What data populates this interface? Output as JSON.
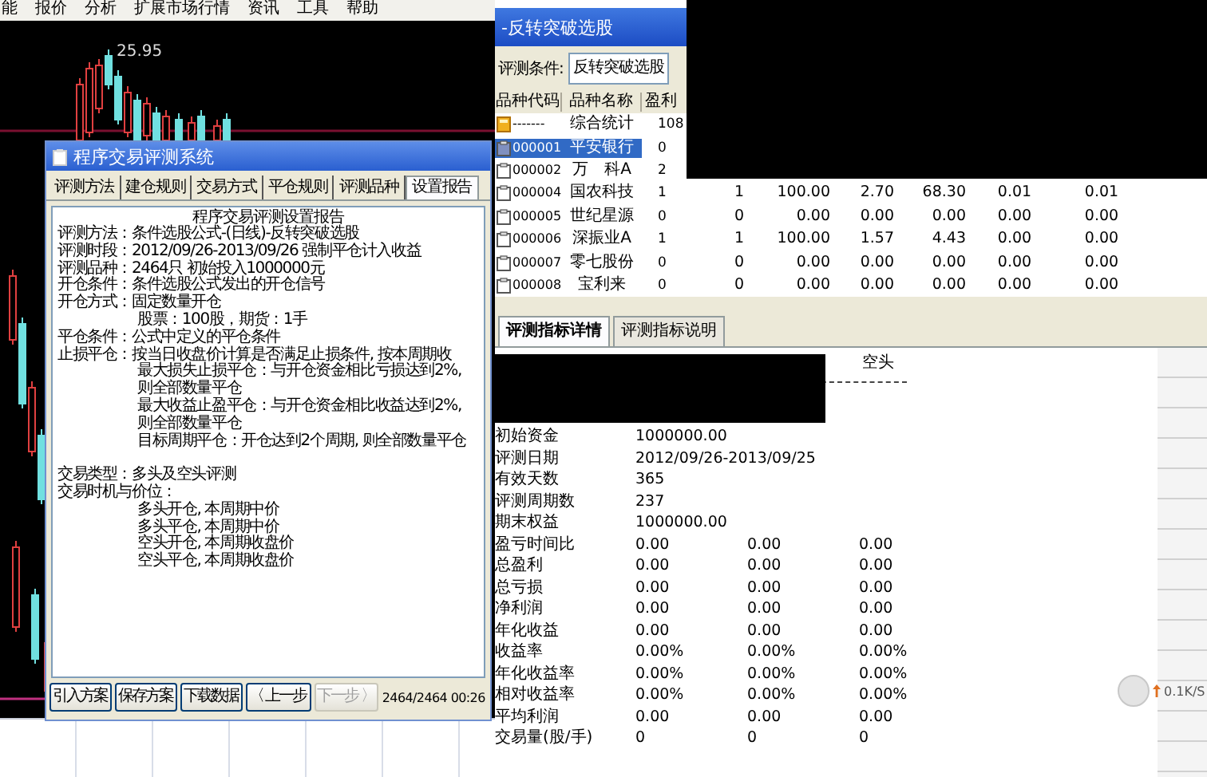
{
  "menu_bar": {
    "items": [
      "能",
      "报价",
      "分析",
      "扩展市场行情",
      "资讯",
      "工具",
      "帮助"
    ]
  },
  "chart": {
    "price_label": "25.95"
  },
  "evaluation_dialog": {
    "title": "程序交易评测系统",
    "tabs": [
      {
        "label": "评测方法",
        "selected": false
      },
      {
        "label": "建仓规则",
        "selected": false
      },
      {
        "label": "交易方式",
        "selected": false
      },
      {
        "label": "平仓规则",
        "selected": false
      },
      {
        "label": "评测品种",
        "selected": false
      },
      {
        "label": "设置报告",
        "selected": true
      }
    ],
    "report": {
      "heading": "程序交易评测设置报告",
      "lines": [
        {
          "kind": "field",
          "label": "评测方法：",
          "text": "条件选股公式-(日线)-反转突破选股"
        },
        {
          "kind": "field",
          "label": "评测时段：",
          "text": "2012/09/26-2013/09/26 强制平仓计入收益"
        },
        {
          "kind": "field",
          "label": "评测品种：",
          "text": "2464只 初始投入1000000元"
        },
        {
          "kind": "field",
          "label": "开仓条件：",
          "text": "条件选股公式发出的开仓信号"
        },
        {
          "kind": "field",
          "label": "开仓方式：",
          "text": "固定数量开仓"
        },
        {
          "kind": "sub",
          "text": "股票：100股，期货：1手"
        },
        {
          "kind": "field",
          "label": "平仓条件：",
          "text": "公式中定义的平仓条件"
        },
        {
          "kind": "field",
          "label": "止损平仓：",
          "text": "按当日收盘价计算是否满足止损条件, 按本周期收"
        },
        {
          "kind": "sub",
          "text": "最大损失止损平仓：与开仓资金相比亏损达到2%, 则全部数量平仓"
        },
        {
          "kind": "sub",
          "text": "最大收益止盈平仓：与开仓资金相比收益达到2%, 则全部数量平仓"
        },
        {
          "kind": "sub",
          "text": "目标周期平仓：开仓达到2个周期, 则全部数量平仓"
        },
        {
          "kind": "gap"
        },
        {
          "kind": "field",
          "label": "交易类型：",
          "text": "多头及空头评测"
        },
        {
          "kind": "field",
          "label": "交易时机与价位："
        },
        {
          "kind": "sub",
          "text": "多头开仓, 本周期中价"
        },
        {
          "kind": "sub",
          "text": "多头平仓, 本周期中价"
        },
        {
          "kind": "sub",
          "text": "空头开仓, 本周期收盘价"
        },
        {
          "kind": "sub",
          "text": "空头平仓, 本周期收盘价"
        }
      ]
    },
    "buttons": [
      {
        "label": "引入方案",
        "disabled": false
      },
      {
        "label": "保存方案",
        "disabled": false
      },
      {
        "label": "下载数据",
        "disabled": false
      },
      {
        "label": "〈 上一步",
        "disabled": false
      },
      {
        "label": "下一步 〉",
        "disabled": true
      }
    ],
    "progress_text": "2464/2464 00:26"
  },
  "screening_dialog": {
    "title": "-反转突破选股",
    "condition_label": "评测条件:",
    "condition_value": "反转突破选股",
    "columns": [
      "品种代码",
      "品种名称",
      "盈利"
    ],
    "rows": [
      {
        "kind": "summary",
        "code": "-------",
        "name": "综合统计",
        "selected": false,
        "values": [
          "108"
        ]
      },
      {
        "kind": "stock",
        "code": "000001",
        "name": "平安银行",
        "selected": true,
        "values": [
          "0"
        ]
      },
      {
        "kind": "stock",
        "code": "000002",
        "name": "万　科A",
        "selected": false,
        "values": [
          "2"
        ]
      },
      {
        "kind": "stock",
        "code": "000004",
        "name": "国农科技",
        "selected": false,
        "values": [
          "1",
          "1",
          "100.00",
          "2.70",
          "68.30",
          "0.01",
          "0.01"
        ]
      },
      {
        "kind": "stock",
        "code": "000005",
        "name": "世纪星源",
        "selected": false,
        "values": [
          "0",
          "0",
          "0.00",
          "0.00",
          "0.00",
          "0.00",
          "0.00"
        ]
      },
      {
        "kind": "stock",
        "code": "000006",
        "name": "深振业A",
        "selected": false,
        "values": [
          "1",
          "1",
          "100.00",
          "1.57",
          "4.43",
          "0.00",
          "0.00"
        ]
      },
      {
        "kind": "stock",
        "code": "000007",
        "name": "零七股份",
        "selected": false,
        "values": [
          "0",
          "0",
          "0.00",
          "0.00",
          "0.00",
          "0.00",
          "0.00"
        ]
      },
      {
        "kind": "stock",
        "code": "000008",
        "name": "宝利来",
        "selected": false,
        "values": [
          "0",
          "0",
          "0.00",
          "0.00",
          "0.00",
          "0.00",
          "0.00"
        ]
      }
    ],
    "tabs": [
      {
        "label": "评测指标详情",
        "selected": true
      },
      {
        "label": "评测指标说明",
        "selected": false
      }
    ],
    "report": {
      "column_header": "空头",
      "rows": [
        {
          "label": "初始资金",
          "values": [
            "1000000.00"
          ]
        },
        {
          "label": "评测日期",
          "values": [
            "2012/09/26-2013/09/25"
          ]
        },
        {
          "label": "有效天数",
          "values": [
            "365"
          ]
        },
        {
          "label": "评测周期数",
          "values": [
            "237"
          ]
        },
        {
          "label": "期末权益",
          "values": [
            "1000000.00"
          ]
        },
        {
          "label": "盈亏时间比",
          "values": [
            "0.00",
            "0.00",
            "0.00"
          ]
        },
        {
          "label": "总盈利",
          "values": [
            "0.00",
            "0.00",
            "0.00"
          ]
        },
        {
          "label": "总亏损",
          "values": [
            "0.00",
            "0.00",
            "0.00"
          ]
        },
        {
          "label": "净利润",
          "values": [
            "0.00",
            "0.00",
            "0.00"
          ]
        },
        {
          "label": "年化收益",
          "values": [
            "0.00",
            "0.00",
            "0.00"
          ]
        },
        {
          "label": "收益率",
          "values": [
            "0.00%",
            "0.00%",
            "0.00%"
          ]
        },
        {
          "label": "年化收益率",
          "values": [
            "0.00%",
            "0.00%",
            "0.00%"
          ]
        },
        {
          "label": "相对收益率",
          "values": [
            "0.00%",
            "0.00%",
            "0.00%"
          ]
        },
        {
          "label": "平均利润",
          "values": [
            "0.00",
            "0.00",
            "0.00"
          ]
        },
        {
          "label": "交易量(股/手)",
          "values": [
            "0",
            "0",
            "0"
          ]
        }
      ]
    }
  },
  "network_widget": {
    "speed": "0.1K/S"
  }
}
